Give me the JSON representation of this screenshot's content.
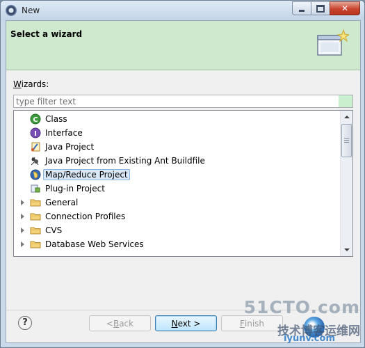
{
  "window": {
    "title": "New",
    "close_symbol": "✕"
  },
  "banner": {
    "title": "Select a wizard"
  },
  "wizards": {
    "label_prefix": "W",
    "label_rest": "izards:",
    "filter_placeholder": "type filter text"
  },
  "tree": {
    "items": [
      {
        "label": "Class",
        "icon": "class-icon",
        "expandable": false
      },
      {
        "label": "Interface",
        "icon": "interface-icon",
        "expandable": false
      },
      {
        "label": "Java Project",
        "icon": "java-project-icon",
        "expandable": false
      },
      {
        "label": "Java Project from Existing Ant Buildfile",
        "icon": "ant-icon",
        "expandable": false
      },
      {
        "label": "Map/Reduce Project",
        "icon": "mapreduce-elephant-icon",
        "expandable": false,
        "selected": true
      },
      {
        "label": "Plug-in Project",
        "icon": "plugin-project-icon",
        "expandable": false
      },
      {
        "label": "General",
        "icon": "folder-icon",
        "expandable": true
      },
      {
        "label": "Connection Profiles",
        "icon": "folder-icon",
        "expandable": true
      },
      {
        "label": "CVS",
        "icon": "folder-icon",
        "expandable": true
      },
      {
        "label": "Database Web Services",
        "icon": "folder-icon",
        "expandable": true
      }
    ]
  },
  "buttons": {
    "help": "?",
    "back_prefix": "< ",
    "back_key": "B",
    "back_rest": "ack",
    "next_prefix": "",
    "next_key": "N",
    "next_rest": "ext >",
    "finish_key": "F",
    "finish_rest": "inish"
  },
  "watermark": {
    "line1": "51CTO.com",
    "line2": "技术博客",
    "line3": "iyunv.com",
    "line2b": "运维网"
  },
  "colors": {
    "banner_bg": "#cfe9cf",
    "selection_bg": "#d9e8f7",
    "default_button_border": "#3c7fb1"
  }
}
